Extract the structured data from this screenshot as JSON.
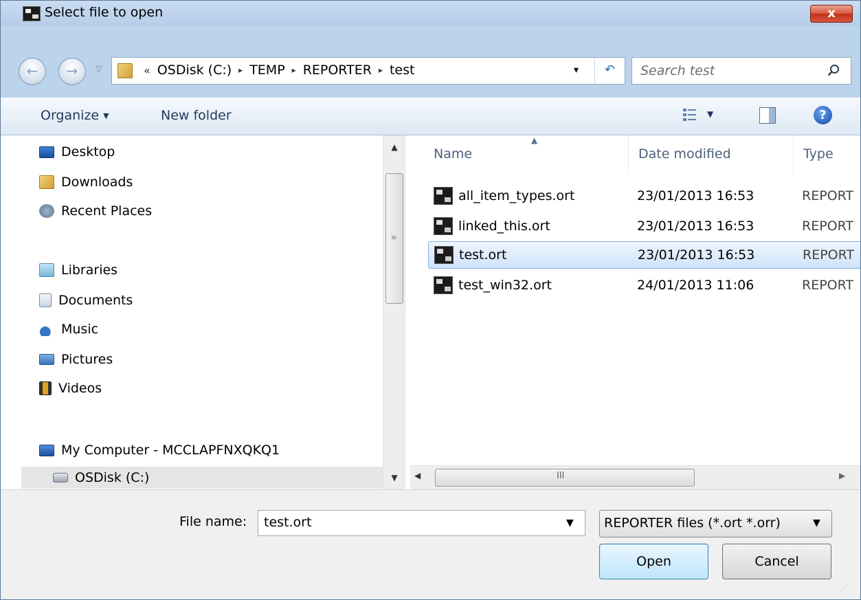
{
  "window": {
    "title": "Select file to open",
    "close_label": "x"
  },
  "address": {
    "overflow": "«",
    "crumbs": [
      "OSDisk (C:)",
      "TEMP",
      "REPORTER",
      "test"
    ],
    "separator": "▸",
    "dropdown": "▾",
    "refresh": "↶"
  },
  "nav_buttons": {
    "back": "←",
    "forward": "→",
    "history": "▽"
  },
  "search": {
    "placeholder": "Search test"
  },
  "toolbar": {
    "organize_label": "Organize",
    "organize_caret": "▼",
    "new_folder_label": "New folder",
    "views_caret": "▼",
    "help_label": "?"
  },
  "nav_pane": {
    "items": [
      {
        "label": "Desktop",
        "icon": "desktop-icon"
      },
      {
        "label": "Downloads",
        "icon": "downloads-folder-icon"
      },
      {
        "label": "Recent Places",
        "icon": "recent-places-icon"
      },
      {
        "label": "Libraries",
        "icon": "libraries-icon"
      },
      {
        "label": "Documents",
        "icon": "documents-icon"
      },
      {
        "label": "Music",
        "icon": "music-icon"
      },
      {
        "label": "Pictures",
        "icon": "pictures-icon"
      },
      {
        "label": "Videos",
        "icon": "videos-icon"
      },
      {
        "label": "My Computer - MCCLAPFNXQKQ1",
        "icon": "computer-icon"
      },
      {
        "label": "OSDisk (C:)",
        "icon": "disk-icon"
      }
    ],
    "scroll_up": "▲",
    "scroll_down": "▼",
    "grip": "≡"
  },
  "file_list": {
    "columns": [
      "Name",
      "Date modified",
      "Type"
    ],
    "sort_indicator": "▲",
    "files": [
      {
        "name": "all_item_types.ort",
        "date": "23/01/2013 16:53",
        "type": "REPORT"
      },
      {
        "name": "linked_this.ort",
        "date": "23/01/2013 16:53",
        "type": "REPORT"
      },
      {
        "name": "test.ort",
        "date": "23/01/2013 16:53",
        "type": "REPORT"
      },
      {
        "name": "test_win32.ort",
        "date": "24/01/2013 11:06",
        "type": "REPORT"
      }
    ],
    "selected_file": "test.ort",
    "scroll_left": "◀",
    "scroll_right": "▶",
    "hgrip": "III"
  },
  "bottom": {
    "file_name_label": "File name:",
    "file_name_value": "test.ort",
    "file_name_drop": "▼",
    "file_type_value": "REPORTER files (*.ort *.orr)",
    "file_type_drop": "▼",
    "open_label": "Open",
    "cancel_label": "Cancel",
    "resize_grip": "⋰"
  },
  "colors": {
    "frame": "#bcd3ec",
    "close_button": "#c4301a",
    "selection": "#cfe3fa",
    "open_button": "#bee6fd"
  }
}
